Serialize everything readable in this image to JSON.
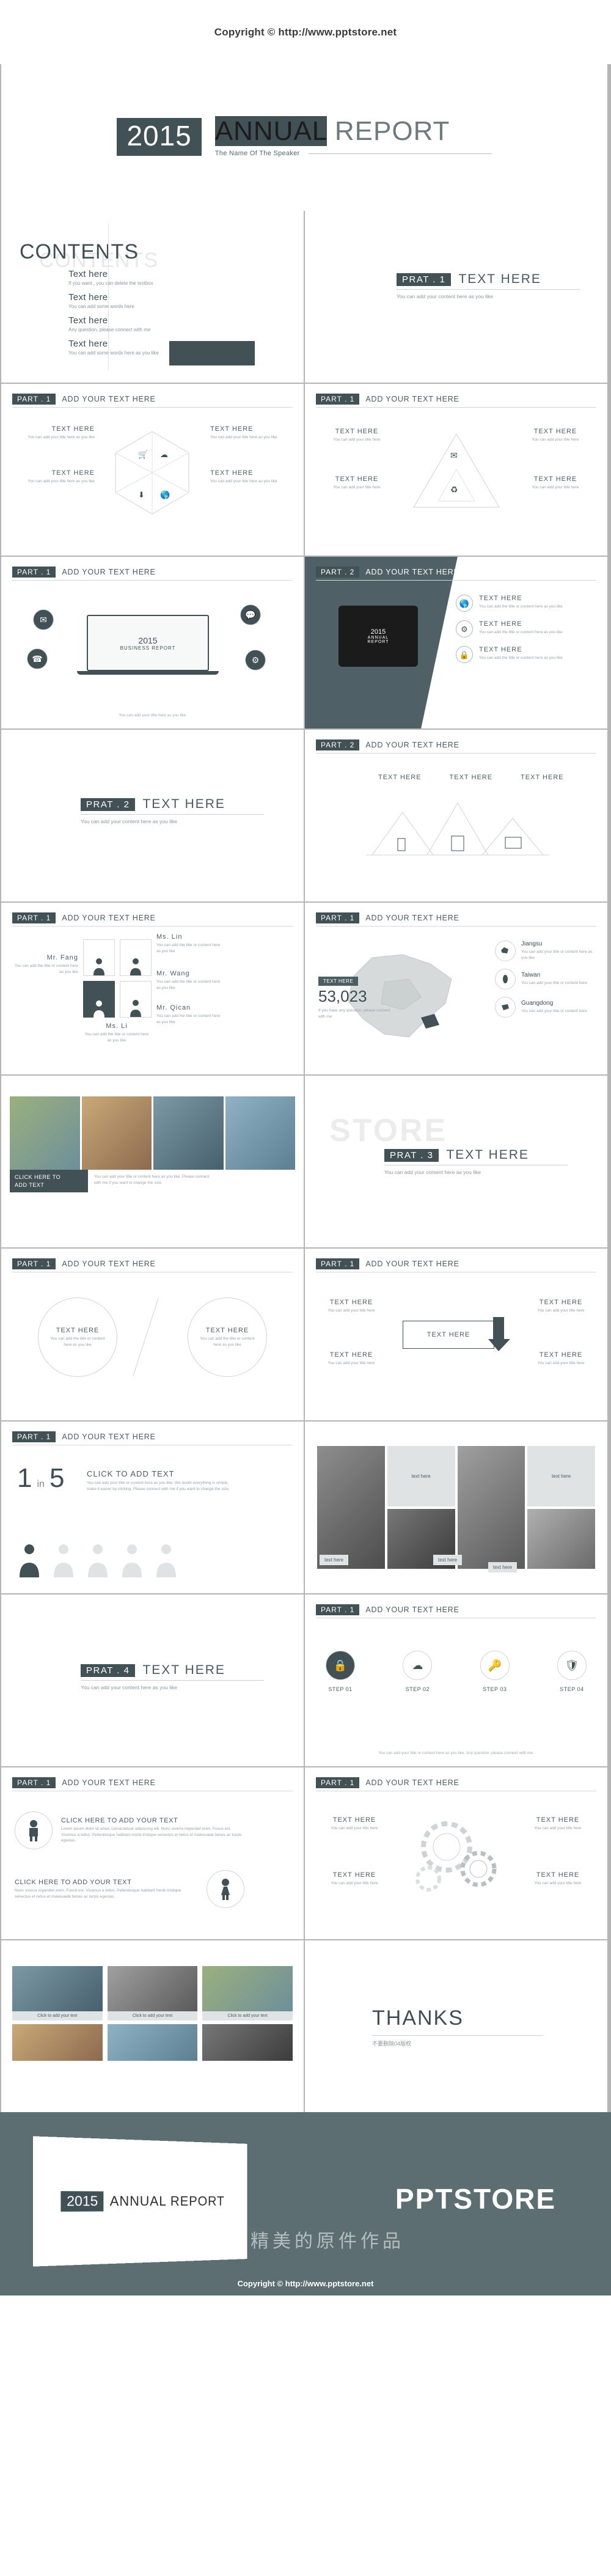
{
  "header": {
    "copyright": "Copyright © http://www.pptstore.net"
  },
  "colors": {
    "accent": "#415156",
    "banner_bg": "#5c6e72",
    "muted": "#8d9599",
    "rule": "#cfcfcf"
  },
  "title_slide": {
    "year": "2015",
    "title_bold": "ANNUAL",
    "title_light": "REPORT",
    "speaker": "The Name Of The Speaker"
  },
  "contents_slide": {
    "heading": "CONTENTS",
    "ghost": "CONTENTS",
    "items": [
      {
        "title": "Text here",
        "desc": "If you want , you can delete the textbox"
      },
      {
        "title": "Text here",
        "desc": "You can add some words here"
      },
      {
        "title": "Text here",
        "desc": "Any question, please connect with me"
      },
      {
        "title": "Text here",
        "desc": "You can add some words here as you like"
      }
    ]
  },
  "common": {
    "part_tag_1": "PART . 1",
    "part_tag_2": "PART . 2",
    "part_title": "ADD YOUR TEXT HERE",
    "text_here": "TEXT HERE",
    "content_note": "You can add your content here as you like",
    "title_note": "You can add your title here as you like",
    "title_note_2": "You can add your title or content here as you like",
    "step_note": "You can add your title or content here as you like. Any question, please connect with me."
  },
  "section_slides": [
    {
      "tag": "PRAT . 1",
      "title": "TEXT HERE",
      "sub": "You can add your content here as you like"
    },
    {
      "tag": "PRAT . 2",
      "title": "TEXT HERE",
      "sub": "You can add your content here as you like"
    },
    {
      "tag": "PRAT . 3",
      "title": "TEXT HERE",
      "sub": "You can add your content here as you like"
    },
    {
      "tag": "PRAT . 4",
      "title": "TEXT HERE",
      "sub": "You can add your content here as you like"
    }
  ],
  "hex_slide": {
    "part_tag": "PART . 1",
    "part_title": "ADD YOUR TEXT HERE",
    "blocks": [
      {
        "title": "TEXT HERE",
        "desc": "You can add your title here as you like"
      },
      {
        "title": "TEXT HERE",
        "desc": "You can add your title here as you like"
      },
      {
        "title": "TEXT HERE",
        "desc": "You can add your title here as you like"
      },
      {
        "title": "TEXT HERE",
        "desc": "You can add your title here as you like"
      }
    ],
    "icons": [
      "cart-icon",
      "cloud-icon",
      "download-icon",
      "globe-icon"
    ]
  },
  "triangle_slide": {
    "part_tag": "PART . 1",
    "part_title": "ADD YOUR TEXT HERE",
    "blocks": [
      {
        "title": "TEXT HERE",
        "desc": "You can add your title here"
      },
      {
        "title": "TEXT HERE",
        "desc": "You can add your title here"
      },
      {
        "title": "TEXT HERE",
        "desc": "You can add your title here"
      },
      {
        "title": "TEXT HERE",
        "desc": "You can add your title here"
      }
    ],
    "icons": [
      "mail-icon",
      "recycle-icon"
    ]
  },
  "laptop_slide": {
    "part_tag": "PART . 1",
    "part_title": "ADD YOUR TEXT HERE",
    "screen_line1": "2015",
    "screen_line2": "BUSINESS REPORT",
    "note": "You can add your title here as you like",
    "icons": [
      "mail-icon",
      "chat-icon",
      "phone-icon",
      "gear-icon"
    ]
  },
  "tablet_slide": {
    "part_tag": "PART . 2",
    "part_title": "ADD YOUR TEXT HERE",
    "screen_line1": "2015",
    "screen_line2": "ANNUAL",
    "screen_line3": "REPORT",
    "items": [
      {
        "title": "TEXT HERE",
        "desc": "You can add the title or content here as you like"
      },
      {
        "title": "TEXT HERE",
        "desc": "You can add the title or content here as you like"
      },
      {
        "title": "TEXT HERE",
        "desc": "You can add the title or content here as you like"
      }
    ],
    "icons": [
      "globe-icon",
      "gear-icon",
      "lock-icon"
    ]
  },
  "mountain_slide": {
    "part_tag": "PART . 2",
    "part_title": "ADD YOUR TEXT HERE",
    "labels": [
      "TEXT HERE",
      "TEXT HERE",
      "TEXT HERE"
    ],
    "devices": [
      "phone-icon",
      "tablet-icon",
      "monitor-icon"
    ]
  },
  "people_slide": {
    "part_tag": "PART . 1",
    "part_title": "ADD YOUR TEXT HERE",
    "people": [
      {
        "name": "Mr. Fang",
        "desc": "You can add the title or content here as you like"
      },
      {
        "name": "Ms. Lin",
        "desc": "You can add the title or content here as you like"
      },
      {
        "name": "Mr. Wang",
        "desc": "You can add the title or content here as you like"
      },
      {
        "name": "Mr. Qican",
        "desc": "You can add the title or content here as you like"
      },
      {
        "name": "Ms. Li",
        "desc": "You can add the title or content here as you like"
      }
    ]
  },
  "map_slide": {
    "part_tag": "PART . 1",
    "part_title": "ADD YOUR TEXT HERE",
    "badge": "TEXT HERE",
    "number": "53,023",
    "bullet": "If you have any question, please connect with me",
    "regions": [
      {
        "name": "Jiangsu",
        "desc": "You can add your title or content here as you like"
      },
      {
        "name": "Taiwan",
        "desc": "You can add your title or content here"
      },
      {
        "name": "Guangdong",
        "desc": "You can add your title or content here"
      }
    ]
  },
  "photo_slide": {
    "caption_line1": "CLICK HERE TO",
    "caption_line2": "ADD TEXT",
    "body": "You can add your title or content here as you like. Please connect with me if you want to change the size."
  },
  "store_slide": {
    "tag": "PRAT . 3",
    "title": "TEXT HERE",
    "sub": "You can add your content here as you like",
    "ghost": "STORE"
  },
  "circles_slide": {
    "part_tag": "PART . 1",
    "part_title": "ADD YOUR TEXT HERE",
    "left": {
      "title": "TEXT HERE",
      "desc": "You can add the title or content here as you like"
    },
    "right": {
      "title": "TEXT HERE",
      "desc": "You can add the title or content here as you like"
    }
  },
  "arrow_slide": {
    "part_tag": "PART . 1",
    "part_title": "ADD YOUR TEXT HERE",
    "center": "TEXT HERE",
    "corners": [
      {
        "title": "TEXT HERE",
        "desc": "You can add your title here"
      },
      {
        "title": "TEXT HERE",
        "desc": "You can add your title here"
      },
      {
        "title": "TEXT HERE",
        "desc": "You can add your title here"
      },
      {
        "title": "TEXT HERE",
        "desc": "You can add your title here"
      }
    ]
  },
  "ratio_slide": {
    "part_tag": "PART . 1",
    "part_title": "ADD YOUR TEXT HERE",
    "big_number": "1",
    "word": "in",
    "second_number": "5",
    "headline": "CLICK TO ADD TEXT",
    "body": "You can add your title or content here as you like. We doubt everything is simple, make it easier by clicking. Please connect with me if you want to change the size."
  },
  "photogrid_slide": {
    "labels": [
      "text here",
      "text here",
      "text here",
      "text here",
      "text here"
    ]
  },
  "steps_slide": {
    "part_tag": "PART . 1",
    "part_title": "ADD YOUR TEXT HERE",
    "steps": [
      {
        "label": "STEP 01",
        "icon": "lock-icon"
      },
      {
        "label": "STEP 02",
        "icon": "cloud-icon"
      },
      {
        "label": "STEP 03",
        "icon": "key-icon"
      },
      {
        "label": "STEP 04",
        "icon": "shield-icon"
      }
    ],
    "note": "You can add your title or content here as you like. Any question, please connect with me."
  },
  "persons_slide": {
    "part_tag": "PART . 1",
    "part_title": "ADD YOUR TEXT HERE",
    "rows": [
      {
        "headline": "CLICK HERE TO ADD YOUR TEXT",
        "body": "Lorem ipsum dolor sit amet, consectetuer adipiscing elit. Nunc viverra imperdiet enim. Fusce est. Vivamus a tellus. Pellentesque habitant morbi tristique senectus et netus et malesuada fames ac turpis egestas.",
        "icon": "man-icon"
      },
      {
        "headline": "CLICK HERE TO ADD YOUR TEXT",
        "body": "Nunc viverra imperdiet enim. Fusce est. Vivamus a tellus. Pellentesque habitant morbi tristique senectus et netus et malesuada fames ac turpis egestas.",
        "icon": "woman-icon"
      }
    ]
  },
  "gears_slide": {
    "part_tag": "PART . 1",
    "part_title": "ADD YOUR TEXT HERE",
    "labels": [
      {
        "title": "TEXT HERE",
        "desc": "You can add your title here"
      },
      {
        "title": "TEXT HERE",
        "desc": "You can add your title here"
      },
      {
        "title": "TEXT HERE",
        "desc": "You can add your title here"
      },
      {
        "title": "TEXT HERE",
        "desc": "You can add your title here"
      }
    ]
  },
  "car_slide": {
    "cards": [
      {
        "label": "Click to add your text"
      },
      {
        "label": "Click to add your text"
      },
      {
        "label": "Click to add your text"
      }
    ]
  },
  "thanks_slide": {
    "title": "THANKS",
    "sub": "不要删除04版权"
  },
  "banner": {
    "year": "2015",
    "title": "ANNUAL REPORT",
    "brand": "PPTSTORE",
    "watermark": "大量精美的原件作品",
    "footer": "Copyright © http://www.pptstore.net"
  }
}
